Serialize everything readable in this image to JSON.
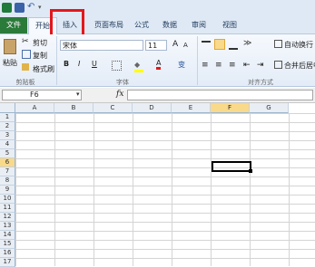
{
  "ribbon_tabs": {
    "file": "文件",
    "home": "开始",
    "insert": "插入",
    "page_layout": "页面布局",
    "formulas": "公式",
    "data": "数据",
    "review": "审阅",
    "view": "视图"
  },
  "clipboard": {
    "paste": "粘贴",
    "cut": "剪切",
    "copy": "复制",
    "format_painter": "格式刷",
    "group_label": "剪贴板"
  },
  "font": {
    "name": "宋体",
    "size": "11",
    "bold": "B",
    "italic": "I",
    "underline": "U",
    "grow": "A",
    "shrink": "A",
    "color_letter": "A",
    "phonetic": "变",
    "group_label": "字体"
  },
  "alignment": {
    "wrap_text": "自动换行",
    "merge_center": "合并后居中",
    "group_label": "对齐方式"
  },
  "formula_bar": {
    "name_box": "F6",
    "fx": "fx",
    "content": ""
  },
  "grid": {
    "columns": [
      "A",
      "B",
      "C",
      "D",
      "E",
      "F",
      "G"
    ],
    "rows": [
      "1",
      "2",
      "3",
      "4",
      "5",
      "6",
      "7",
      "8",
      "9",
      "10",
      "11",
      "12",
      "13",
      "14",
      "15",
      "16",
      "17"
    ],
    "active_cell": "F6"
  },
  "colors": {
    "file_tab": "#2a7a3a",
    "highlight_box": "#e3171c",
    "selected_header": "#f9d98a"
  }
}
